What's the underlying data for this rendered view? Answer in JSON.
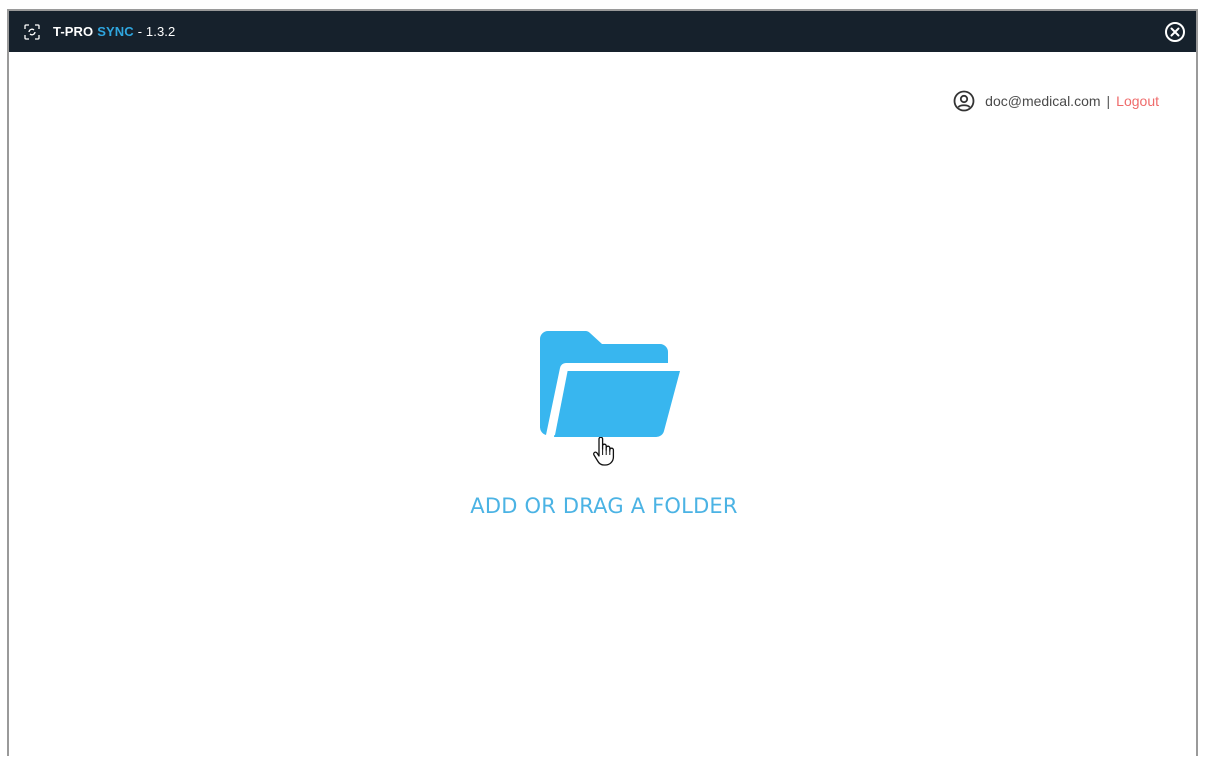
{
  "window": {
    "title_brand": "T-PRO",
    "title_product": "SYNC",
    "title_version": "- 1.3.2",
    "app_icon": "sync-corners-icon",
    "close_icon": "close-circle-icon"
  },
  "user": {
    "email": "doc@medical.com",
    "separator": "|",
    "logout_label": "Logout",
    "icon": "user-circle-icon"
  },
  "main": {
    "drop_label": "ADD OR DRAG A FOLDER",
    "folder_icon": "folder-open-icon",
    "cursor_icon": "hand-pointer-icon"
  },
  "colors": {
    "titlebar_bg": "#16212c",
    "accent_blue": "#2fa6df",
    "folder_blue": "#38b6ef",
    "logout_red": "#ef6b6b"
  }
}
